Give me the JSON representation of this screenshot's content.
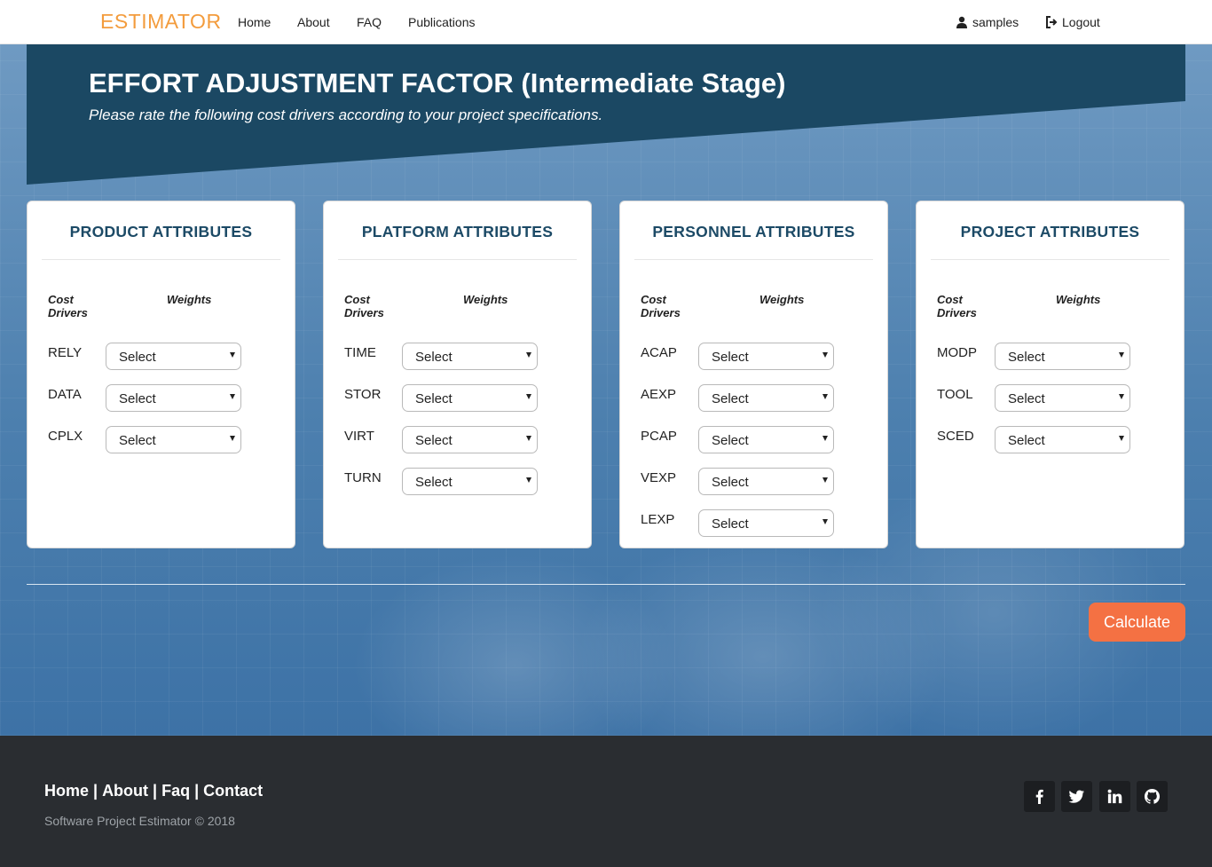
{
  "nav": {
    "brand": "ESTIMATOR",
    "links": [
      "Home",
      "About",
      "FAQ",
      "Publications"
    ],
    "user": "samples",
    "logout": "Logout"
  },
  "header": {
    "title": "EFFORT ADJUSTMENT FACTOR (Intermediate Stage)",
    "subtitle": "Please rate the following cost drivers according to your project specifications."
  },
  "columns": {
    "drivers_header": "Cost Drivers",
    "weights_header": "Weights"
  },
  "select_placeholder": "Select",
  "cards": [
    {
      "title": "PRODUCT ATTRIBUTES",
      "drivers": [
        "RELY",
        "DATA",
        "CPLX"
      ]
    },
    {
      "title": "PLATFORM ATTRIBUTES",
      "drivers": [
        "TIME",
        "STOR",
        "VIRT",
        "TURN"
      ]
    },
    {
      "title": "PERSONNEL ATTRIBUTES",
      "drivers": [
        "ACAP",
        "AEXP",
        "PCAP",
        "VEXP",
        "LEXP"
      ]
    },
    {
      "title": "PROJECT ATTRIBUTES",
      "drivers": [
        "MODP",
        "TOOL",
        "SCED"
      ]
    }
  ],
  "calculate_label": "Calculate",
  "footer": {
    "links": [
      "Home",
      "About",
      "Faq",
      "Contact"
    ],
    "separator": "|",
    "copyright": "Software Project Estimator © 2018",
    "social_icons": [
      "facebook-icon",
      "twitter-icon",
      "linkedin-icon",
      "github-icon"
    ]
  },
  "colors": {
    "brand": "#f39c3d",
    "banner": "#1b4863",
    "card_title": "#1c4a66",
    "calculate": "#f47143",
    "footer": "#2a2d31"
  }
}
